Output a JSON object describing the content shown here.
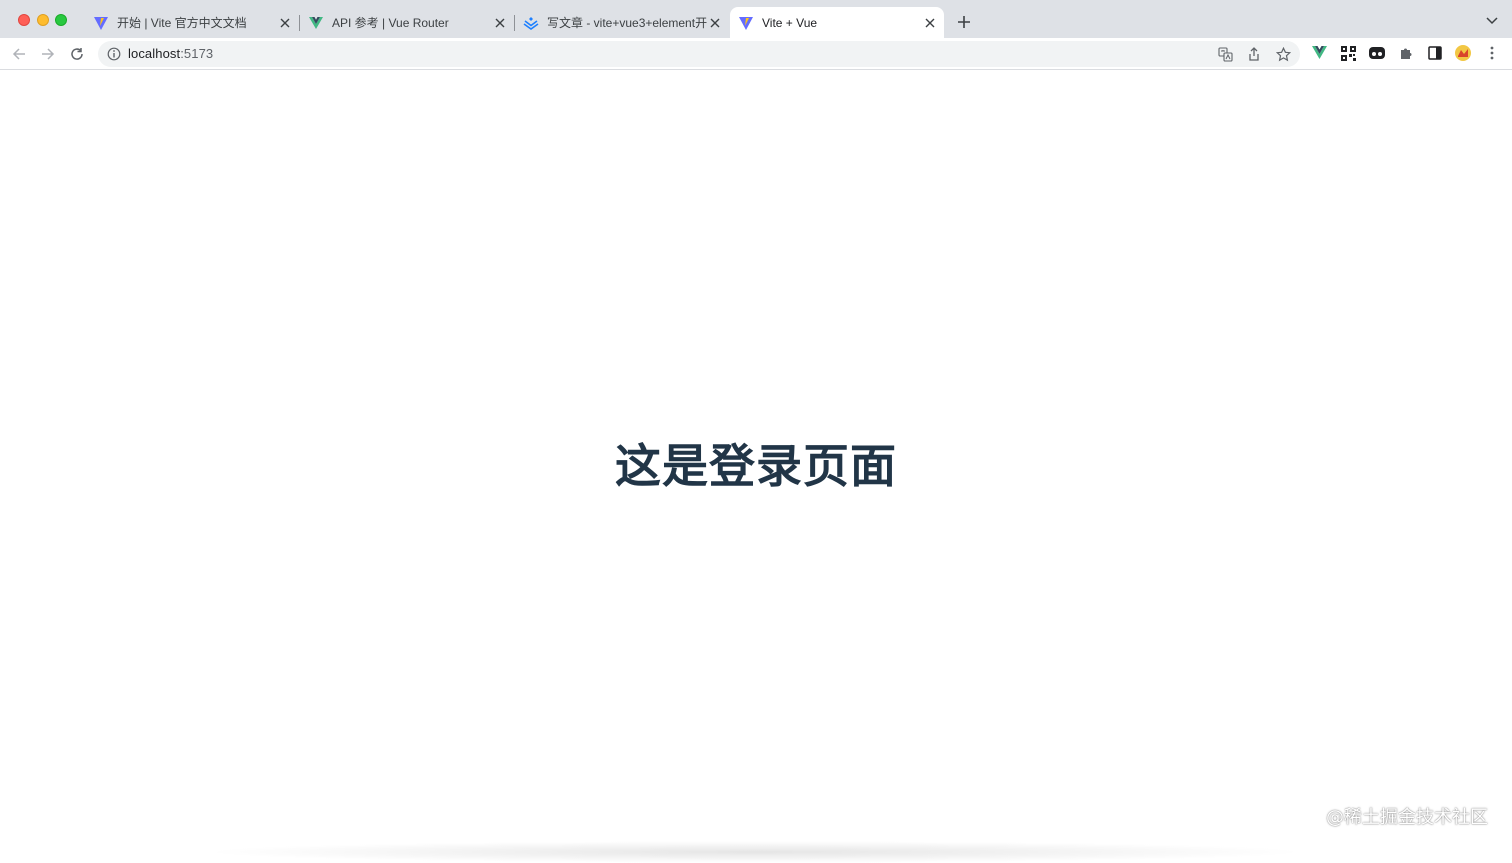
{
  "browser": {
    "tabs": [
      {
        "title": "开始 | Vite 官方中文文档",
        "favicon": "vite-logo-icon",
        "active": false
      },
      {
        "title": "API 参考 | Vue Router",
        "favicon": "vue-logo-icon",
        "active": false
      },
      {
        "title": "写文章 - vite+vue3+element开",
        "favicon": "juejin-logo-icon",
        "active": false
      },
      {
        "title": "Vite + Vue",
        "favicon": "vite-logo-icon",
        "active": true
      }
    ],
    "address": {
      "host": "localhost",
      "port": ":5173"
    }
  },
  "page": {
    "heading": "这是登录页面"
  },
  "watermark": "@稀土掘金技术社区",
  "colors": {
    "tabstrip": "#dee1e6",
    "heading": "#213547",
    "omnibox": "#f1f3f4"
  }
}
